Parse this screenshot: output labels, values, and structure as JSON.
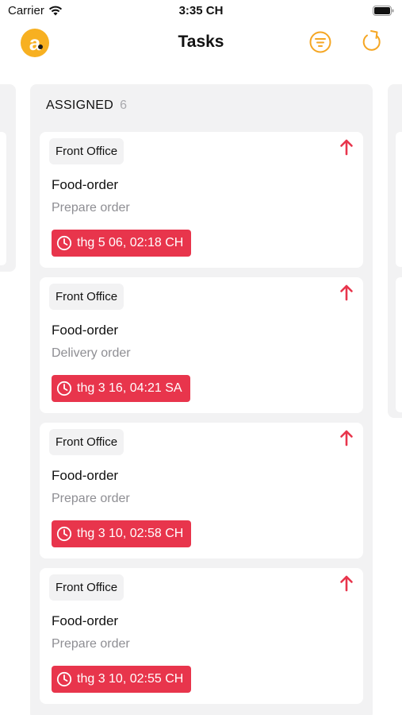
{
  "status_bar": {
    "carrier": "Carrier",
    "time": "3:35 CH"
  },
  "nav": {
    "title": "Tasks",
    "logo_letter": "a"
  },
  "colors": {
    "accent": "#f7b021",
    "danger": "#e8354c",
    "column_bg": "#f2f2f3",
    "muted_text": "#8e8e93"
  },
  "column": {
    "title": "ASSIGNED",
    "count": "6"
  },
  "cards": [
    {
      "tag": "Front Office",
      "title": "Food-order",
      "subtitle": "Prepare order",
      "due": "thg 5 06, 02:18 CH",
      "priority_icon": "arrow-up-icon"
    },
    {
      "tag": "Front Office",
      "title": "Food-order",
      "subtitle": "Delivery order",
      "due": "thg 3 16, 04:21 SA",
      "priority_icon": "arrow-up-icon"
    },
    {
      "tag": "Front Office",
      "title": "Food-order",
      "subtitle": "Prepare order",
      "due": "thg 3 10, 02:58 CH",
      "priority_icon": "arrow-up-icon"
    },
    {
      "tag": "Front Office",
      "title": "Food-order",
      "subtitle": "Prepare order",
      "due": "thg 3 10, 02:55 CH",
      "priority_icon": "arrow-up-icon"
    }
  ]
}
